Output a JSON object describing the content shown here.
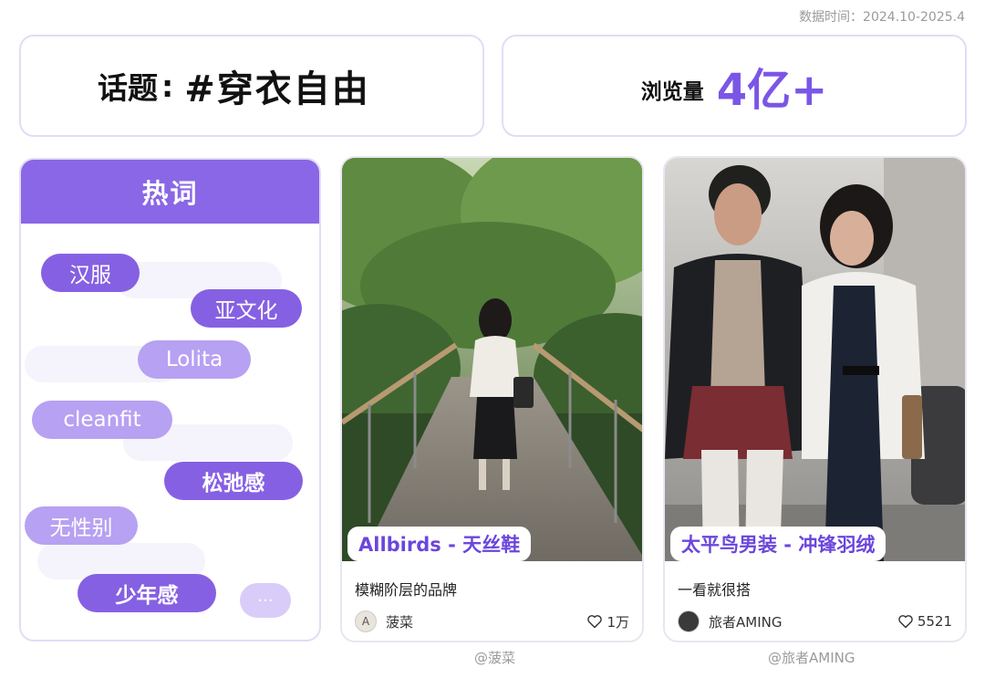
{
  "data_range": "数据时间：2024.10-2025.4",
  "topic": {
    "label": "话题",
    "colon": ":",
    "value": "#穿衣自由"
  },
  "views": {
    "label": "浏览量",
    "value": "4亿+"
  },
  "hot_words": {
    "title": "热词",
    "items": [
      "汉服",
      "亚文化",
      "Lolita",
      "cleanfit",
      "松弛感",
      "无性别",
      "少年感"
    ],
    "more": "···"
  },
  "cards": [
    {
      "brand": "Allbirds - 天丝鞋",
      "description": "模糊阶层的品牌",
      "author": "菠菜",
      "avatar_letter": "A",
      "likes": "1万",
      "credit": "@菠菜"
    },
    {
      "brand": "太平鸟男装 - 冲锋羽绒",
      "description": "一看就很搭",
      "author": "旅者AMING",
      "avatar_letter": "",
      "likes": "5521",
      "credit": "@旅者AMING"
    }
  ],
  "colors": {
    "accent": "#7b56e6",
    "header": "#8a67e6",
    "pill_dark": "#8660e2",
    "pill_light": "#b7a1f2"
  }
}
